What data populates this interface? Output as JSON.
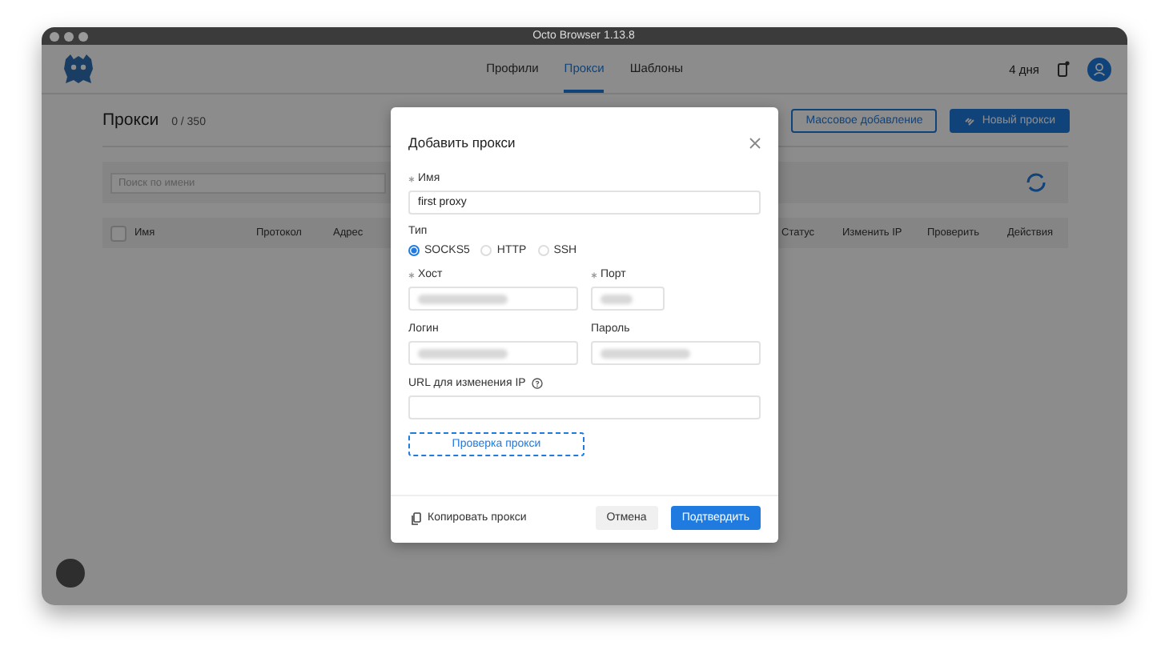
{
  "window": {
    "title": "Octo Browser 1.13.8"
  },
  "nav": {
    "tabs": [
      {
        "label": "Профили",
        "selected": false
      },
      {
        "label": "Прокси",
        "selected": true
      },
      {
        "label": "Шаблоны",
        "selected": false
      }
    ],
    "days_left": "4 дня",
    "notification": true
  },
  "page": {
    "title": "Прокси",
    "count": "0 / 350",
    "buttons": [
      {
        "label": "Массовое добавление",
        "kind": "outline"
      },
      {
        "label": "Новый прокси",
        "kind": "primary"
      }
    ],
    "search": {
      "placeholder": "Поиск по имени"
    },
    "table": {
      "select_all": {
        "checked": false
      },
      "columns": [
        "Имя",
        "Протокол",
        "Адрес",
        "Статус",
        "Изменить IP",
        "Проверить",
        "Действия"
      ]
    }
  },
  "dialog": {
    "title": "Добавить прокси",
    "name_field": {
      "label": "Имя",
      "required": true,
      "value": "first proxy"
    },
    "type": {
      "label": "Тип",
      "options": [
        {
          "label": "SOCKS5",
          "selected": true
        },
        {
          "label": "HTTP",
          "selected": false
        },
        {
          "label": "SSH",
          "selected": false
        }
      ]
    },
    "host_field": {
      "label": "Хост",
      "required": true,
      "obscured": true
    },
    "port_field": {
      "label": "Порт",
      "required": true,
      "obscured": true
    },
    "login_field": {
      "label": "Логин",
      "required": false,
      "obscured": true
    },
    "password_field": {
      "label": "Пароль",
      "required": false,
      "obscured": true
    },
    "url_field": {
      "label": "URL для изменения IP",
      "help": true
    },
    "check_button": "Проверка прокси",
    "copy_button": "Копировать прокси",
    "cancel_button": "Отмена",
    "confirm_button": "Подтвердить"
  }
}
